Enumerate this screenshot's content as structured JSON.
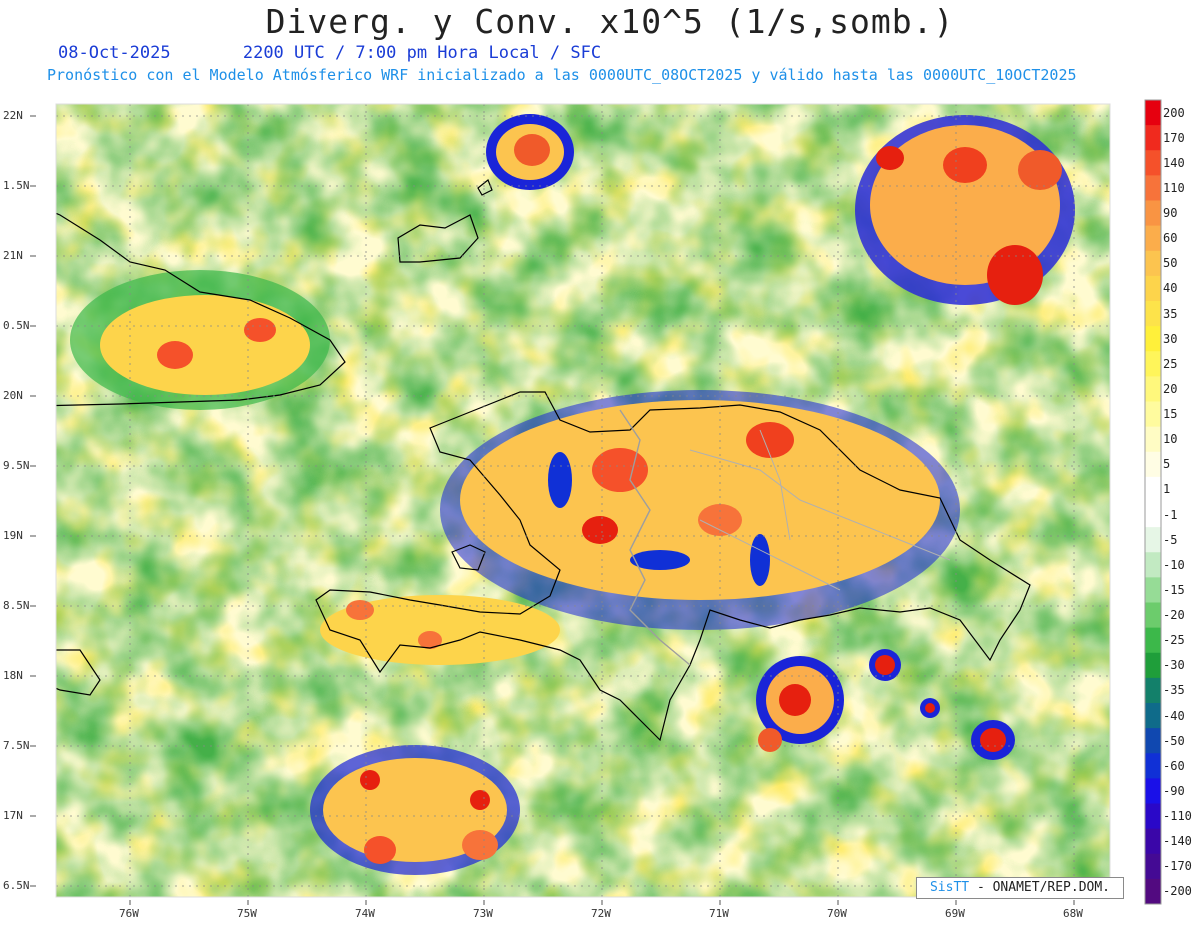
{
  "header": {
    "title": "Diverg. y Conv. x10^5 (1/s,somb.)",
    "date": "08-Oct-2025",
    "time": "2200 UTC / 7:00 pm Hora Local / SFC",
    "forecast": "Pronóstico con el Modelo Atmósferico WRF inicializado a las 0000UTC_08OCT2025 y válido hasta las  0000UTC_10OCT2025"
  },
  "axes": {
    "y_labels": [
      "22N",
      "1.5N",
      "21N",
      "0.5N",
      "20N",
      "9.5N",
      "19N",
      "8.5N",
      "18N",
      "7.5N",
      "17N",
      "6.5N"
    ],
    "x_labels": [
      "76W",
      "75W",
      "74W",
      "73W",
      "72W",
      "71W",
      "70W",
      "69W",
      "68W"
    ]
  },
  "colorbar": {
    "labels": [
      "200",
      "170",
      "140",
      "110",
      "90",
      "60",
      "50",
      "40",
      "35",
      "30",
      "25",
      "20",
      "15",
      "10",
      "5",
      "1",
      "-1",
      "-5",
      "-10",
      "-15",
      "-20",
      "-25",
      "-30",
      "-35",
      "-40",
      "-50",
      "-60",
      "-90",
      "-110",
      "-140",
      "-170",
      "-200"
    ],
    "colors": [
      "#e6000f",
      "#f02a1e",
      "#f5512a",
      "#f7733a",
      "#f99443",
      "#fbad4b",
      "#fcc44f",
      "#fdd44b",
      "#fde34a",
      "#fff03a",
      "#fff55a",
      "#fff87c",
      "#fffb9e",
      "#fffcc4",
      "#fffde4",
      "#ffffff",
      "#ffffff",
      "#e6f6e6",
      "#c2eac2",
      "#96dc96",
      "#6ccc6c",
      "#3cb84a",
      "#1f9e3a",
      "#13806a",
      "#0f6b8a",
      "#1048b0",
      "#1030d6",
      "#1a10e8",
      "#2a08c8",
      "#3a06a8",
      "#440a94",
      "#520a80"
    ]
  },
  "credit": {
    "brand": "SisTT",
    "text": " - ONAMET/REP.DOM."
  }
}
